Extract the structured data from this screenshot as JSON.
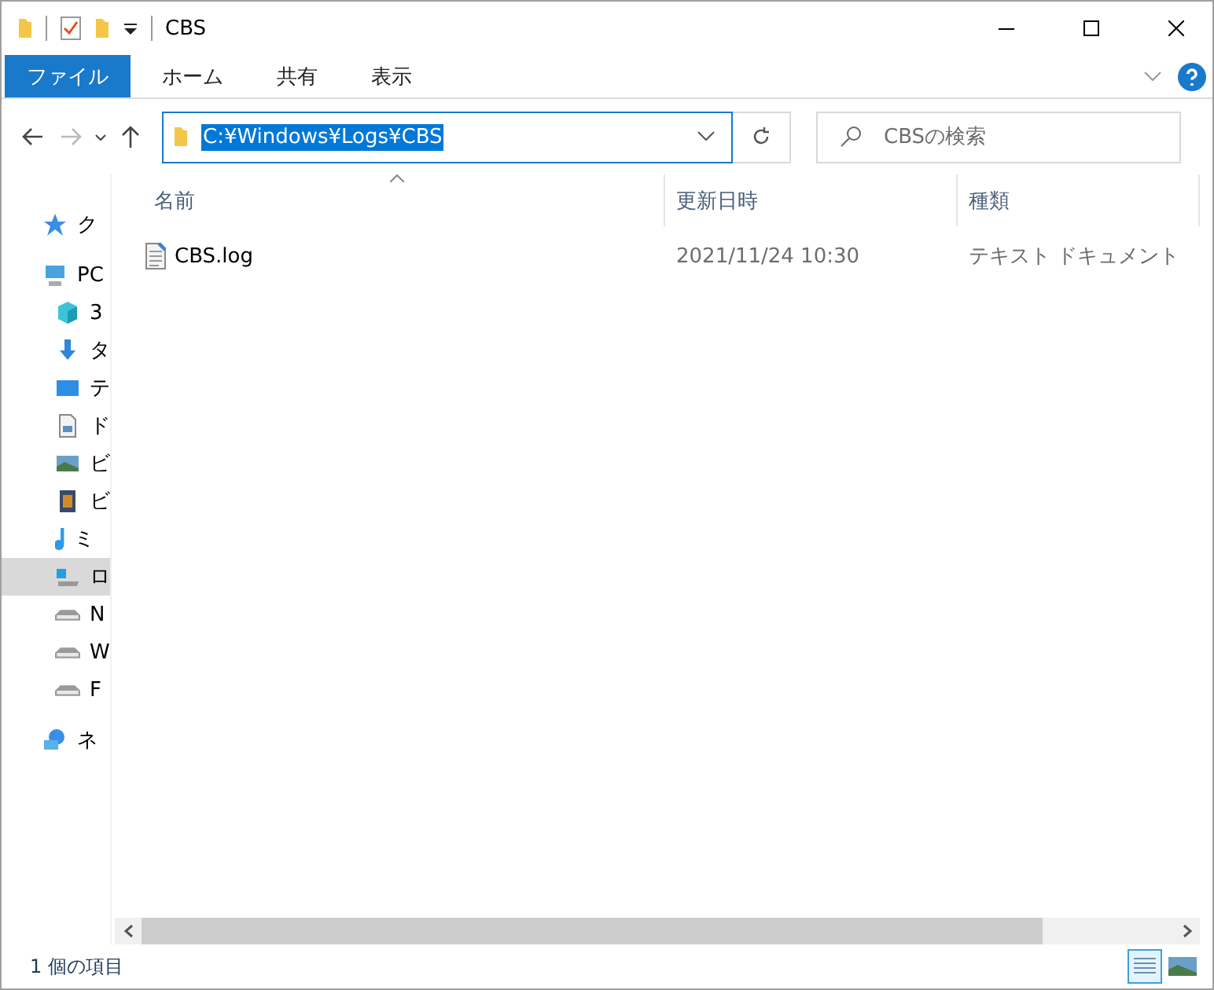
{
  "window": {
    "title": "CBS"
  },
  "ribbon": {
    "tabs": [
      {
        "label": "ファイル",
        "selected": true
      },
      {
        "label": "ホーム",
        "selected": false
      },
      {
        "label": "共有",
        "selected": false
      },
      {
        "label": "表示",
        "selected": false
      }
    ]
  },
  "address": {
    "value": "C:¥Windows¥Logs¥CBS"
  },
  "search": {
    "placeholder": "CBSの検索"
  },
  "sidebar": {
    "items": [
      {
        "label": "ク",
        "kind": "star",
        "selected": false
      },
      {
        "label": "PC",
        "kind": "pc",
        "selected": false,
        "children": [
          {
            "label": "3",
            "kind": "cube",
            "selected": false
          },
          {
            "label": "タ",
            "kind": "download",
            "selected": false
          },
          {
            "label": "テ",
            "kind": "desktop",
            "selected": false
          },
          {
            "label": "ド",
            "kind": "document",
            "selected": false
          },
          {
            "label": "ビ",
            "kind": "image",
            "selected": false
          },
          {
            "label": "ビ",
            "kind": "video",
            "selected": false
          },
          {
            "label": "ミ",
            "kind": "music",
            "selected": false
          },
          {
            "label": "ロ",
            "kind": "system-drive",
            "selected": true
          },
          {
            "label": "N",
            "kind": "drive",
            "selected": false
          },
          {
            "label": "W",
            "kind": "drive",
            "selected": false
          },
          {
            "label": "F",
            "kind": "drive",
            "selected": false
          }
        ]
      },
      {
        "label": "ネ",
        "kind": "network",
        "selected": false
      }
    ]
  },
  "table": {
    "columns": [
      "名前",
      "更新日時",
      "種類"
    ],
    "rows": [
      {
        "name": "CBS.log",
        "modified": "2021/11/24 10:30",
        "type": "テキスト ドキュメント"
      }
    ]
  },
  "status_bar": {
    "text": "1 個の項目",
    "views": [
      {
        "kind": "details",
        "selected": true
      },
      {
        "kind": "tiles",
        "selected": false
      }
    ]
  }
}
